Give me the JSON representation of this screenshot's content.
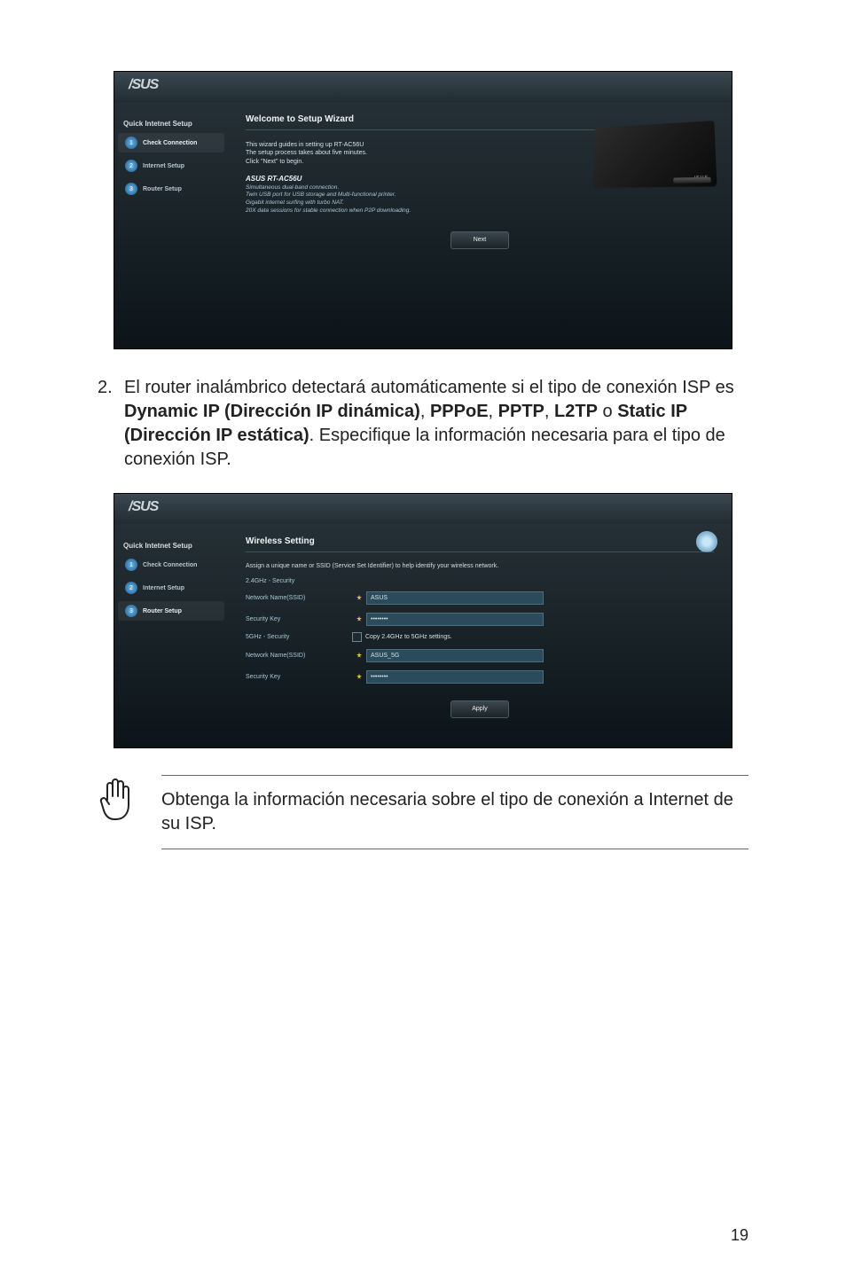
{
  "page_number": "19",
  "screenshot1": {
    "logo": "/SUS",
    "sidebar_title": "Quick Intetnet Setup",
    "steps": [
      {
        "num": "1",
        "label": "Check Connection"
      },
      {
        "num": "2",
        "label": "Internet Setup"
      },
      {
        "num": "3",
        "label": "Router Setup"
      }
    ],
    "title": "Welcome to Setup Wizard",
    "intro1": "This wizard guides in setting up RT-AC56U",
    "intro2": "The setup process takes about five minutes.",
    "intro3": "Click \"Next\" to begin.",
    "product": "ASUS RT-AC56U",
    "feat1": "Simultaneous dual-band connection.",
    "feat2": "Twin USB port for USB storage and Multi-functional printer.",
    "feat3": "Gigabit internet surfing with turbo NAT.",
    "feat4": "20X data sessions for stable connection when P2P downloading.",
    "router_brand": "/SUS",
    "next": "Next"
  },
  "paragraph": {
    "number": "2.",
    "pre": "El router inalámbrico detectará automáticamente si el tipo de conexión ISP es ",
    "b1": "Dynamic IP (Dirección IP dinámica)",
    "sep1": ", ",
    "b2": "PPPoE",
    "sep2": ", ",
    "b3": "PPTP",
    "sep3": ", ",
    "b4": "L2TP",
    "sep4": " o ",
    "b5": "Static IP (Dirección IP estática)",
    "post": ". Especifique la información necesaria para el tipo de conexión ISP."
  },
  "screenshot2": {
    "logo": "/SUS",
    "sidebar_title": "Quick Intetnet Setup",
    "steps": [
      {
        "num": "1",
        "label": "Check Connection"
      },
      {
        "num": "2",
        "label": "Internet Setup"
      },
      {
        "num": "3",
        "label": "Router Setup"
      }
    ],
    "title": "Wireless Setting",
    "note": "Assign a unique name or SSID (Service Set Identifier) to help identify your wireless network.",
    "sec24": "2.4GHz - Security",
    "ssid24_label": "Network Name(SSID)",
    "ssid24_value": "ASUS",
    "key24_label": "Security Key",
    "key24_value": "••••••••",
    "sec5": "5GHz - Security",
    "copy_label": "Copy 2.4GHz to 5GHz settings.",
    "ssid5_label": "Network Name(SSID)",
    "ssid5_value": "ASUS_5G",
    "key5_label": "Security Key",
    "key5_value": "••••••••",
    "apply": "Apply"
  },
  "note": "Obtenga la información necesaria sobre el tipo de conexión a Internet de su ISP."
}
